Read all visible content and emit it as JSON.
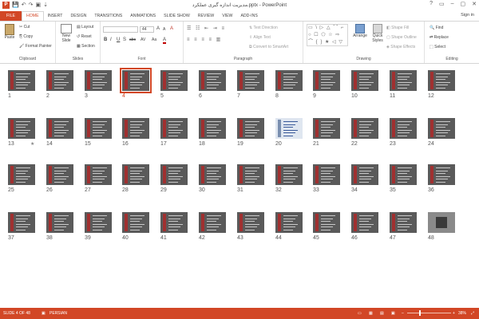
{
  "window": {
    "title": "مدیریت اندازه گیری عملکرد.pptx - PowerPoint",
    "controls": [
      "?",
      "▭",
      "–",
      "▢",
      "✕"
    ]
  },
  "qat": {
    "app_badge": "P",
    "save": "💾",
    "undo": "↶",
    "redo": "↷",
    "present": "▣",
    "more": "⇣"
  },
  "tabs": [
    "FILE",
    "HOME",
    "INSERT",
    "DESIGN",
    "TRANSITIONS",
    "ANIMATIONS",
    "SLIDE SHOW",
    "REVIEW",
    "VIEW",
    "ADD-INS"
  ],
  "active_tab": "HOME",
  "sign_in": "Sign in",
  "ribbon": {
    "clipboard": {
      "label": "Clipboard",
      "paste": "Paste",
      "cut": "Cut",
      "copy": "Copy",
      "format_painter": "Format Painter"
    },
    "slides": {
      "label": "Slides",
      "new_slide": "New Slide",
      "layout": "Layout",
      "reset": "Reset",
      "section": "Section"
    },
    "font": {
      "label": "Font",
      "size": "44",
      "bold": "B",
      "italic": "I",
      "underline": "U",
      "strike": "S",
      "abc": "abc",
      "spacing": "AV",
      "case": "Aa",
      "color": "A",
      "grow": "A",
      "shrink": "A",
      "clear": "A"
    },
    "paragraph": {
      "label": "Paragraph",
      "text_direction": "Text Direction",
      "align_text": "Align Text",
      "convert": "Convert to SmartArt"
    },
    "drawing": {
      "label": "Drawing",
      "shapes": "▭ \\ ▷ △ ⌒ ⌐ ○ ☐ ⬠ ☆ ⇨ ⌒ { } ★ ◁ ▽ ⬡",
      "arrange": "Arrange",
      "quick_styles": "Quick Styles",
      "shape_fill": "Shape Fill",
      "shape_outline": "Shape Outline",
      "shape_effects": "Shape Effects"
    },
    "editing": {
      "label": "Editing",
      "find": "Find",
      "replace": "Replace",
      "select": "Select"
    }
  },
  "slides": {
    "total": 48,
    "selected": 4,
    "numbers": [
      "1",
      "2",
      "3",
      "4",
      "5",
      "6",
      "7",
      "8",
      "9",
      "10",
      "11",
      "12",
      "13",
      "14",
      "15",
      "16",
      "17",
      "18",
      "19",
      "20",
      "21",
      "22",
      "23",
      "24",
      "25",
      "26",
      "27",
      "28",
      "29",
      "30",
      "31",
      "32",
      "33",
      "34",
      "35",
      "36",
      "37",
      "38",
      "39",
      "40",
      "41",
      "42",
      "43",
      "44",
      "45",
      "46",
      "47",
      "48"
    ],
    "star_on": 13,
    "star_symbol": "★",
    "light_slide": 20,
    "photo_slide": 48
  },
  "status": {
    "slide_info": "SLIDE 4 OF 48",
    "language": "PERSIAN",
    "zoom": "38%",
    "zoom_fraction": 0.38
  },
  "colors": {
    "accent": "#d24726",
    "thumb_bg": "#5a5a5a",
    "thumb_stripe": "#a03030"
  }
}
